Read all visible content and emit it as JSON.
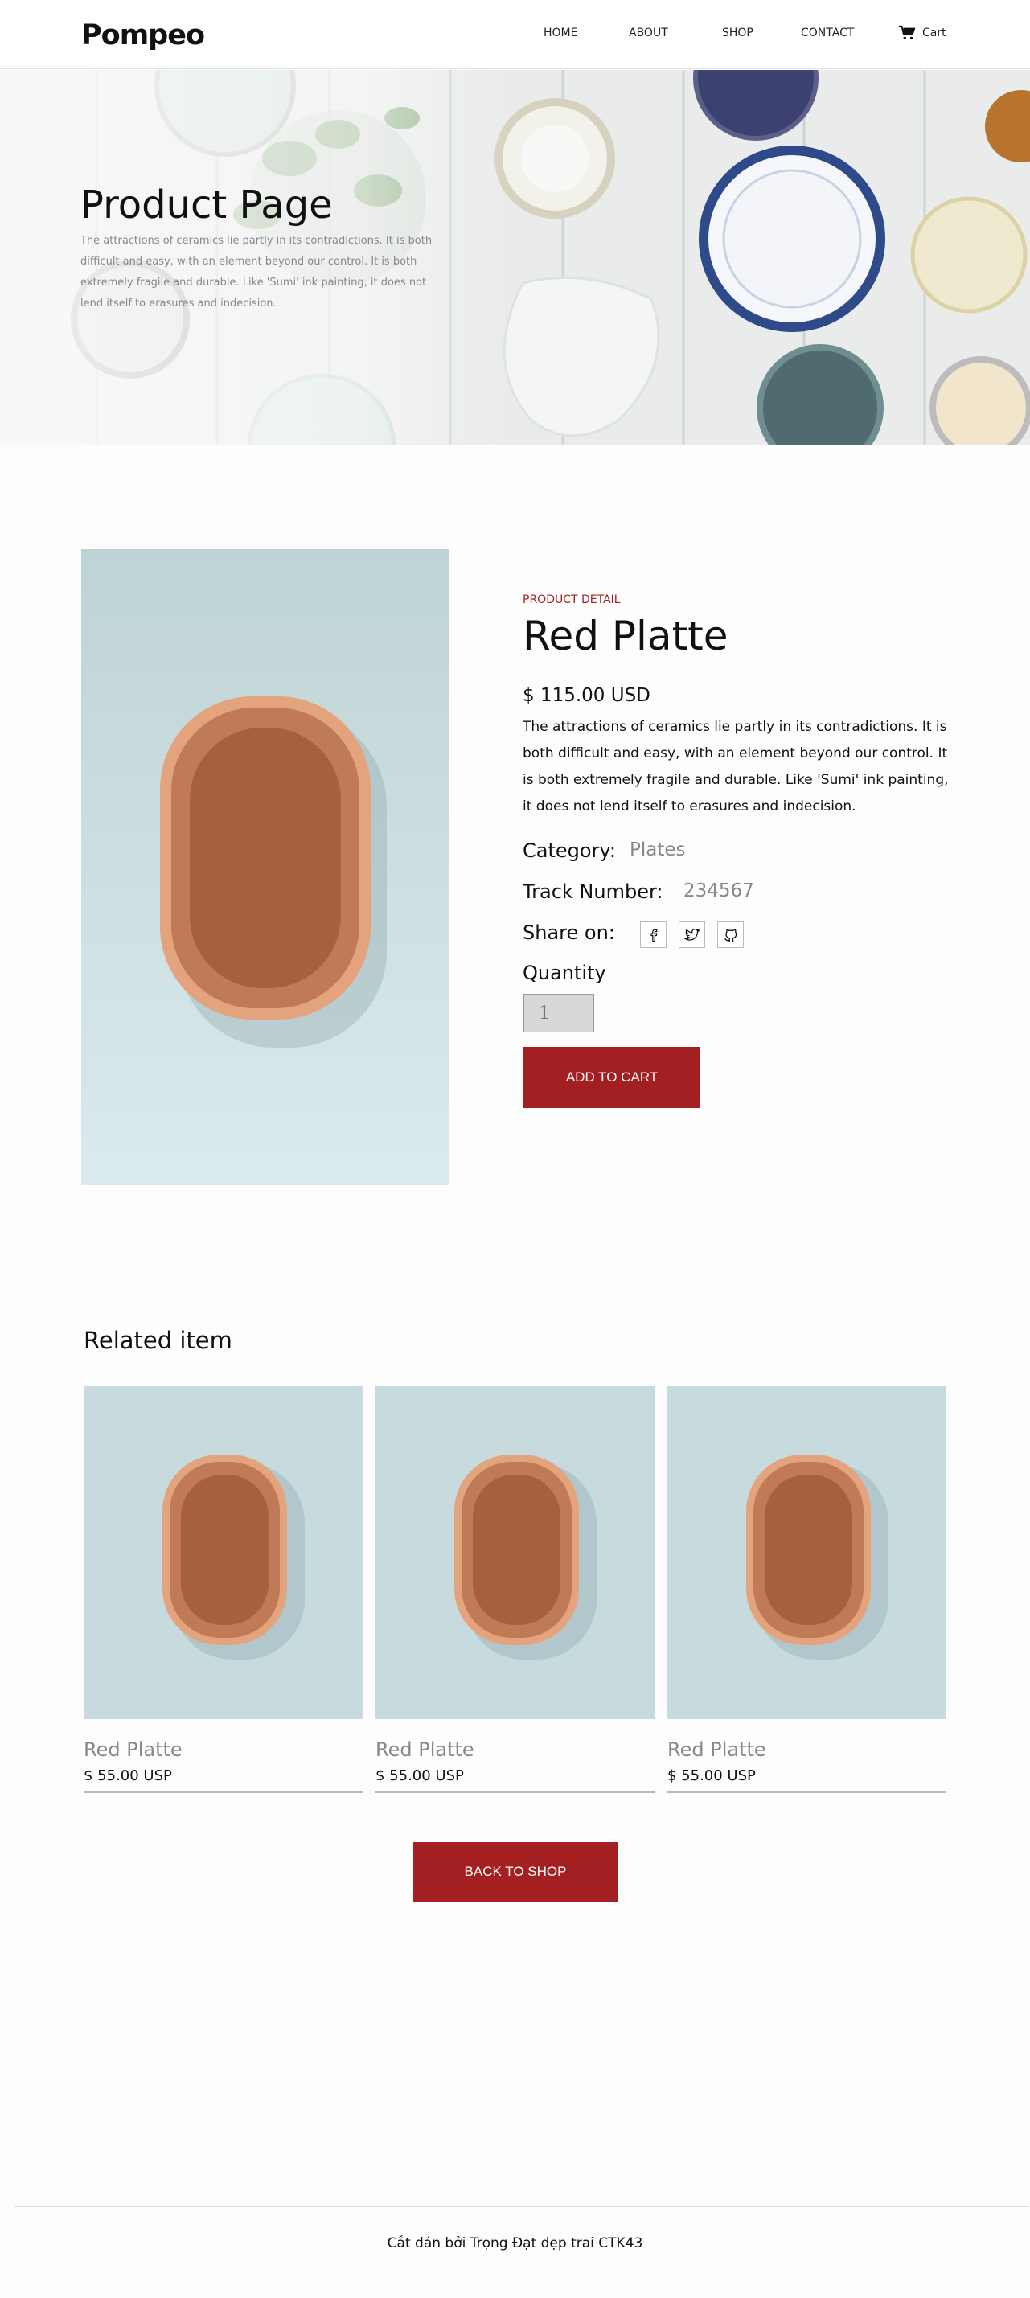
{
  "brand": {
    "logo": "Pompeo",
    "accent_color": "#a41f22"
  },
  "nav": {
    "items": [
      "HOME",
      "ABOUT",
      "SHOP",
      "CONTACT"
    ],
    "cart_label": "Cart",
    "cart_icon": "cart-icon"
  },
  "hero": {
    "title": "Product Page",
    "description": "The attractions of ceramics lie partly in its contradictions. It is both difficult and easy, with an element beyond our control. It is both extremely fragile and durable. Like 'Sumi' ink painting, it does not lend itself to erasures and indecision."
  },
  "product": {
    "eyebrow": "PRODUCT DETAIL",
    "name": "Red Platte",
    "price": "$ 115.00 USD",
    "description": "The attractions of ceramics lie partly in its contradictions. It is both difficult and easy, with an element beyond our control. It is both extremely fragile and durable. Like 'Sumi' ink painting, it does not lend itself to erasures and indecision.",
    "category_label": "Category:",
    "category_value": "Plates",
    "track_label": "Track Number:",
    "track_value": "234567",
    "share_label": "Share on:",
    "share_icons": [
      "facebook-icon",
      "twitter-icon",
      "github-icon"
    ],
    "quantity_label": "Quantity",
    "quantity_value": "1",
    "add_to_cart_label": "ADD TO CART"
  },
  "related": {
    "title": "Related item",
    "items": [
      {
        "name": "Red Platte",
        "price": "$ 55.00 USP"
      },
      {
        "name": "Red Platte",
        "price": "$ 55.00 USP"
      },
      {
        "name": "Red Platte",
        "price": "$ 55.00 USP"
      }
    ],
    "back_label": "BACK TO SHOP"
  },
  "footer": {
    "text": "Cắt dán bởi Trọng Đạt đẹp trai CTK43"
  }
}
